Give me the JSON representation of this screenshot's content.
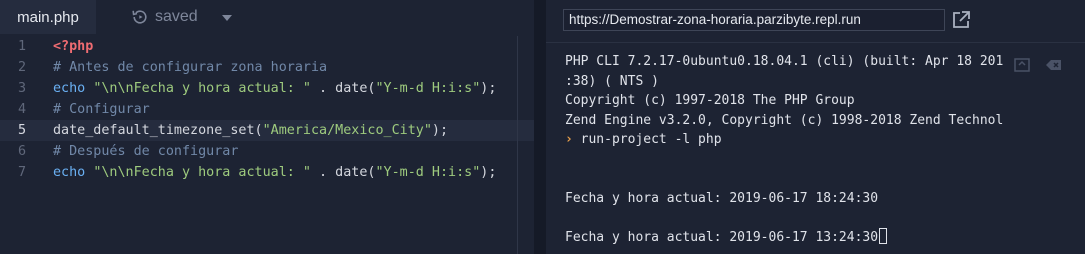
{
  "editor": {
    "tab_label": "main.php",
    "saved_label": "saved",
    "lines": [
      {
        "n": "1",
        "tokens": [
          {
            "t": "tag",
            "v": "<?php"
          }
        ]
      },
      {
        "n": "2",
        "tokens": [
          {
            "t": "cmt",
            "v": "# Antes de configurar zona horaria"
          }
        ]
      },
      {
        "n": "3",
        "tokens": [
          {
            "t": "kw",
            "v": "echo "
          },
          {
            "t": "str",
            "v": "\"\\n\\nFecha y hora actual: \""
          },
          {
            "t": "fn",
            "v": " . date("
          },
          {
            "t": "str",
            "v": "\"Y-m-d H:i:s\""
          },
          {
            "t": "fn",
            "v": ");"
          }
        ]
      },
      {
        "n": "4",
        "tokens": [
          {
            "t": "cmt",
            "v": "# Configurar"
          }
        ]
      },
      {
        "n": "5",
        "current": true,
        "tokens": [
          {
            "t": "fn",
            "v": "date_default_timezone_set("
          },
          {
            "t": "str",
            "v": "\"America/Mexico_City\""
          },
          {
            "t": "fn",
            "v": ");"
          }
        ]
      },
      {
        "n": "6",
        "tokens": [
          {
            "t": "cmt",
            "v": "# Después de configurar"
          }
        ]
      },
      {
        "n": "7",
        "tokens": [
          {
            "t": "kw",
            "v": "echo "
          },
          {
            "t": "str",
            "v": "\"\\n\\nFecha y hora actual: \""
          },
          {
            "t": "fn",
            "v": " . date("
          },
          {
            "t": "str",
            "v": "\"Y-m-d H:i:s\""
          },
          {
            "t": "fn",
            "v": ");"
          }
        ]
      }
    ]
  },
  "console": {
    "url": "https://Demostrar-zona-horaria.parzibyte.repl.run",
    "output": [
      {
        "text": "PHP CLI 7.2.17-0ubuntu0.18.04.1 (cli) (built: Apr 18 201"
      },
      {
        "text": ":38) ( NTS )"
      },
      {
        "text": "Copyright (c) 1997-2018 The PHP Group"
      },
      {
        "text": "Zend Engine v3.2.0, Copyright (c) 1998-2018 Zend Technol"
      },
      {
        "prompt": "›",
        "text": " run-project -l php"
      },
      {
        "text": ""
      },
      {
        "text": ""
      },
      {
        "text": "Fecha y hora actual: 2019-06-17 18:24:30"
      },
      {
        "text": ""
      },
      {
        "text": "Fecha y hora actual: 2019-06-17 13:24:30",
        "cursor": true
      }
    ]
  },
  "icons": {
    "history": "history-icon",
    "dropdown": "chevron-down-icon",
    "open_tab": "external-link-icon",
    "console_a": "expand-console-icon",
    "console_b": "clear-console-icon"
  }
}
